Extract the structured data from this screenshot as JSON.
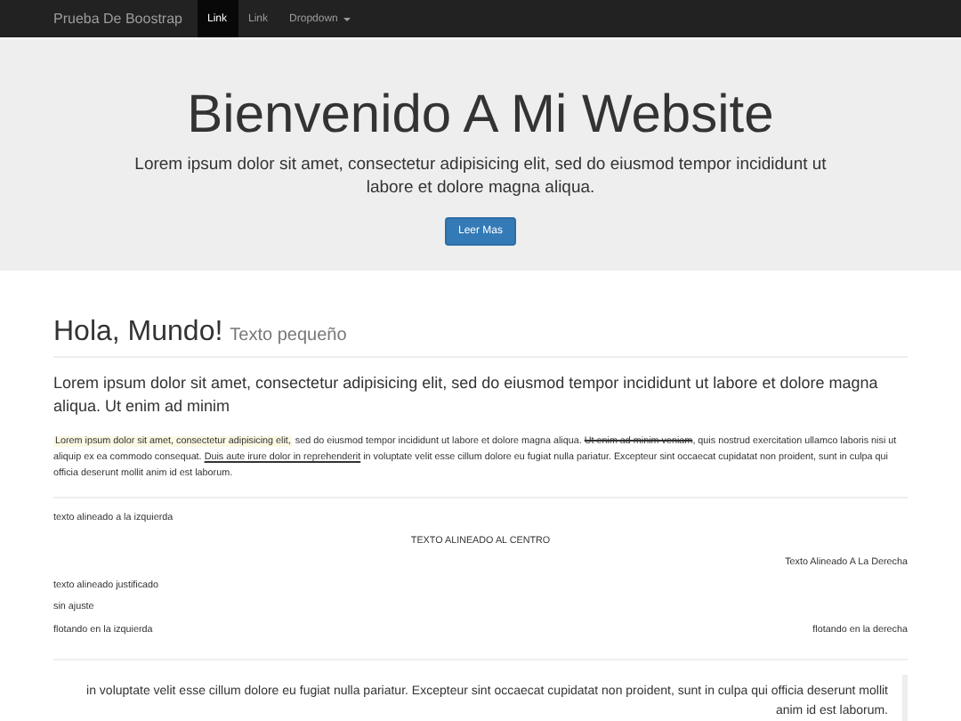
{
  "navbar": {
    "brand": "Prueba De Boostrap",
    "items": [
      {
        "label": "Link",
        "selected": true,
        "kind": "link"
      },
      {
        "label": "Link",
        "selected": false,
        "kind": "link"
      },
      {
        "label": "Dropdown",
        "selected": false,
        "kind": "dropdown"
      }
    ]
  },
  "jumbotron": {
    "title": "Bienvenido A Mi Website",
    "lead": "Lorem ipsum dolor sit amet, consectetur adipisicing elit, sed do eiusmod tempor incididunt ut labore et dolore magna aliqua.",
    "button": "Leer Mas"
  },
  "heading": {
    "title": "Hola, Mundo!",
    "small": "Texto pequeño"
  },
  "lead": "Lorem ipsum dolor sit amet, consectetur adipisicing elit, sed do eiusmod tempor incididunt ut labore et dolore magna aliqua. Ut enim ad minim",
  "paragraph": [
    {
      "kind": "mark",
      "text": "Lorem ipsum dolor sit amet, consectetur adipisicing elit,"
    },
    {
      "kind": "plain",
      "text": " sed do eiusmod tempor incididunt ut labore et dolore magna aliqua. "
    },
    {
      "kind": "del",
      "text": "Ut enim ad minim veniam"
    },
    {
      "kind": "plain",
      "text": ", quis nostrud exercitation ullamco laboris nisi ut aliquip ex ea commodo consequat. "
    },
    {
      "kind": "ins",
      "text": "Duis aute irure dolor in reprehenderit"
    },
    {
      "kind": "plain",
      "text": " in voluptate velit esse cillum dolore eu fugiat nulla pariatur. Excepteur sint occaecat cupidatat non proident, sunt in culpa qui officia deserunt mollit anim id est laborum."
    }
  ],
  "aligned_texts": [
    {
      "kind": "left",
      "text": "texto alineado a la izquierda"
    },
    {
      "kind": "center",
      "text": "TEXTO ALINEADO AL CENTRO"
    },
    {
      "kind": "right",
      "text": "Texto Alineado A La Derecha"
    },
    {
      "kind": "left",
      "text": "texto alineado justificado"
    },
    {
      "kind": "left",
      "text": "sin ajuste"
    },
    {
      "kind": "split",
      "text": "flotando en la izquierda",
      "text_right": "flotando en la derecha"
    }
  ],
  "blockquote": "in voluptate velit esse cillum dolore eu fugiat nulla pariatur. Excepteur sint occaecat cupidatat non proident, sunt in culpa qui officia deserunt mollit anim id est laborum."
}
